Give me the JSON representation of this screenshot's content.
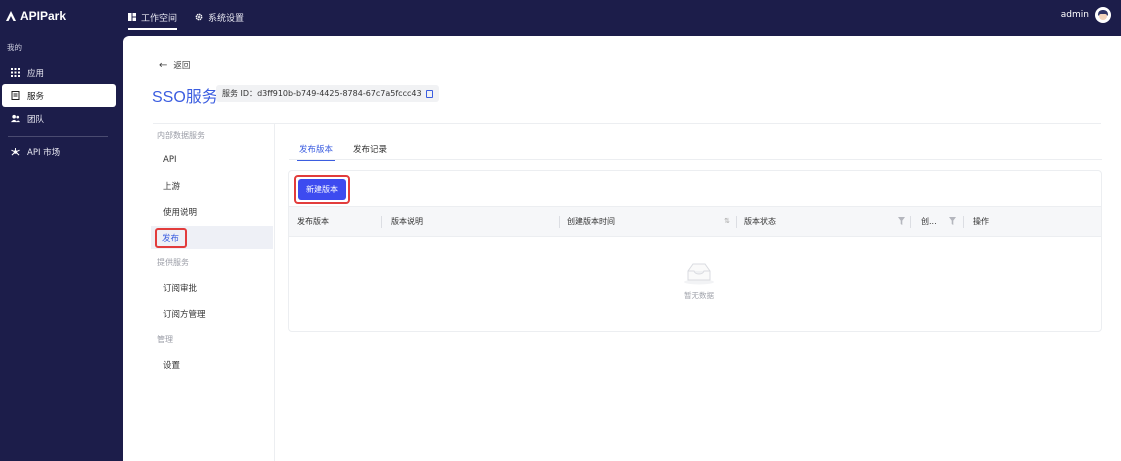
{
  "brand": {
    "name": "APIPark"
  },
  "topnav": {
    "tabs": [
      {
        "label": "工作空间",
        "icon": "dashboard-icon",
        "active": true
      },
      {
        "label": "系统设置",
        "icon": "gear-icon",
        "active": false
      }
    ]
  },
  "user": {
    "name": "admin"
  },
  "sidebar": {
    "section_label": "我的",
    "items": [
      {
        "label": "应用",
        "icon": "grid-icon"
      },
      {
        "label": "服务",
        "icon": "server-icon",
        "active": true
      },
      {
        "label": "团队",
        "icon": "team-icon"
      },
      {
        "label": "API 市场",
        "icon": "market-icon"
      }
    ]
  },
  "page": {
    "back_label": "返回",
    "title": "SSO服务",
    "service_id_label": "服务 ID：",
    "service_id": "d3ff910b-b749-4425-8784-67c7a5fccc43"
  },
  "subnav": {
    "groups": [
      {
        "label": "内部数据服务",
        "items": [
          "API",
          "上游",
          "使用说明",
          "发布"
        ]
      },
      {
        "label": "提供服务",
        "items": [
          "订阅审批",
          "订阅方管理"
        ]
      },
      {
        "label": "管理",
        "items": [
          "设置"
        ]
      }
    ],
    "active_item": "发布"
  },
  "tabs": [
    {
      "label": "发布版本",
      "active": true
    },
    {
      "label": "发布记录",
      "active": false
    }
  ],
  "toolbar": {
    "new_version_label": "新建版本"
  },
  "table": {
    "columns": [
      "发布版本",
      "版本说明",
      "创建版本时间",
      "版本状态",
      "创...",
      "操作"
    ],
    "rows": [],
    "empty_text": "暂无数据"
  },
  "colors": {
    "nav_bg": "#1c1d4a",
    "accent": "#3b5de0",
    "primary_button": "#3d4bf0",
    "highlight_box": "#e23c3c"
  }
}
